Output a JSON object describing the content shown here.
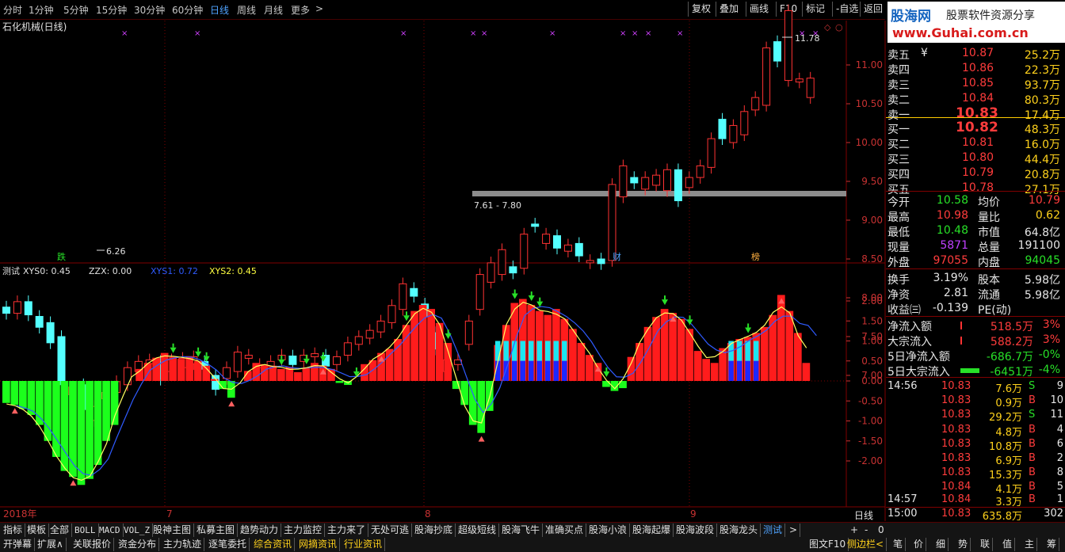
{
  "toolbar": {
    "periods": [
      "分时",
      "1分钟",
      "5分钟",
      "15分钟",
      "30分钟",
      "60分钟",
      "日线",
      "周线",
      "月线",
      "更多"
    ],
    "active_period": "日线",
    "buttons": [
      "复权",
      "叠加",
      "画线",
      "F10",
      "标记",
      "-自选",
      "返回"
    ]
  },
  "brand": {
    "name": "股海网",
    "slogan": "股票软件资源分享",
    "url": "www.Guhai.com.cn"
  },
  "chart": {
    "title": "石化机械(日线)",
    "high_label": "11.78",
    "low_label": "6.26",
    "zone_label": "7.61 - 7.80",
    "events": [
      "跌",
      "财",
      "榜"
    ],
    "price_axis": [
      "11.00",
      "10.50",
      "10.00",
      "9.50",
      "9.00",
      "8.50",
      "8.00",
      "7.50",
      "7.00"
    ],
    "indicator_header": {
      "name": "测试",
      "xys0": "XYS0: 0.45",
      "zzx": "ZZX: 0.00",
      "xys1": "XYS1: 0.72",
      "xys2": "XYS2: 0.45"
    },
    "indicator_axis": [
      "2.00",
      "1.50",
      "1.00",
      "0.50",
      "0.00",
      "-0.50",
      "-1.00",
      "-1.50",
      "-2.00"
    ],
    "date_labels": [
      "2018年",
      "7",
      "8",
      "9"
    ],
    "period_label": "日线"
  },
  "chart_data": {
    "type": "candlestick",
    "title": "石化机械(日线)",
    "ylim": [
      6.5,
      12.0
    ],
    "candles": [
      {
        "o": 7.88,
        "c": 7.8
      },
      {
        "o": 7.8,
        "c": 7.95
      },
      {
        "o": 7.95,
        "c": 7.78
      },
      {
        "o": 7.76,
        "c": 7.62
      },
      {
        "o": 7.68,
        "c": 7.42
      },
      {
        "o": 7.5,
        "c": 6.88
      },
      {
        "o": 6.75,
        "c": 6.85
      },
      {
        "o": 6.88,
        "c": 6.56
      },
      {
        "o": 6.42,
        "c": 6.6
      },
      {
        "o": 6.7,
        "c": 6.78
      },
      {
        "o": 6.78,
        "c": 6.92
      },
      {
        "o": 6.88,
        "c": 7.1
      },
      {
        "o": 7.05,
        "c": 7.18
      },
      {
        "o": 7.15,
        "c": 7.2
      },
      {
        "o": 7.18,
        "c": 6.95
      },
      {
        "o": 7.05,
        "c": 7.2
      },
      {
        "o": 7.1,
        "c": 7.22
      },
      {
        "o": 7.15,
        "c": 7.24
      },
      {
        "o": 7.18,
        "c": 7.08
      },
      {
        "o": 7.0,
        "c": 6.82
      },
      {
        "o": 6.96,
        "c": 7.1
      },
      {
        "o": 7.05,
        "c": 7.3
      },
      {
        "o": 7.22,
        "c": 7.26
      },
      {
        "o": 7.1,
        "c": 7.14
      },
      {
        "o": 7.12,
        "c": 7.18
      },
      {
        "o": 7.2,
        "c": 7.26
      },
      {
        "o": 7.25,
        "c": 7.14
      },
      {
        "o": 7.18,
        "c": 7.26
      },
      {
        "o": 7.24,
        "c": 7.28
      },
      {
        "o": 7.26,
        "c": 7.12
      },
      {
        "o": 7.14,
        "c": 7.24
      },
      {
        "o": 7.26,
        "c": 7.42
      },
      {
        "o": 7.4,
        "c": 7.5
      },
      {
        "o": 7.48,
        "c": 7.58
      },
      {
        "o": 7.56,
        "c": 7.7
      },
      {
        "o": 7.68,
        "c": 7.9
      },
      {
        "o": 7.85,
        "c": 8.18
      },
      {
        "o": 8.12,
        "c": 8.02
      },
      {
        "o": 7.92,
        "c": 7.76
      },
      {
        "o": 7.55,
        "c": 7.34
      },
      {
        "o": 7.05,
        "c": 7.2
      },
      {
        "o": 7.14,
        "c": 7.2
      },
      {
        "o": 7.4,
        "c": 7.7
      },
      {
        "o": 7.85,
        "c": 8.3
      },
      {
        "o": 8.2,
        "c": 8.45
      },
      {
        "o": 8.3,
        "c": 8.62
      },
      {
        "o": 8.4,
        "c": 8.32
      },
      {
        "o": 8.38,
        "c": 8.82
      },
      {
        "o": 8.95,
        "c": 8.92
      },
      {
        "o": 8.7,
        "c": 8.82
      },
      {
        "o": 8.8,
        "c": 8.64
      },
      {
        "o": 8.6,
        "c": 8.68
      },
      {
        "o": 8.7,
        "c": 8.54
      },
      {
        "o": 8.45,
        "c": 8.48
      },
      {
        "o": 8.5,
        "c": 8.44
      },
      {
        "o": 8.48,
        "c": 9.46
      },
      {
        "o": 9.3,
        "c": 9.7
      },
      {
        "o": 9.55,
        "c": 9.48
      },
      {
        "o": 9.4,
        "c": 9.55
      },
      {
        "o": 9.45,
        "c": 9.58
      },
      {
        "o": 9.38,
        "c": 9.65
      },
      {
        "o": 9.65,
        "c": 9.25
      },
      {
        "o": 9.42,
        "c": 9.55
      },
      {
        "o": 9.55,
        "c": 9.7
      },
      {
        "o": 9.68,
        "c": 10.05
      },
      {
        "o": 10.3,
        "c": 10.05
      },
      {
        "o": 10.0,
        "c": 10.22
      },
      {
        "o": 10.1,
        "c": 10.4
      },
      {
        "o": 10.42,
        "c": 10.58
      },
      {
        "o": 10.48,
        "c": 11.22
      },
      {
        "o": 11.3,
        "c": 11.05
      },
      {
        "o": 10.8,
        "c": 11.7
      },
      {
        "o": 10.78,
        "c": 10.82
      },
      {
        "o": 10.58,
        "c": 10.83
      }
    ],
    "indicator": {
      "bars": [
        -0.55,
        -0.6,
        -0.7,
        -0.85,
        -1.1,
        -1.5,
        -1.9,
        -2.25,
        -2.4,
        -2.6,
        -2.45,
        -2.1,
        -1.5,
        -1.1,
        0,
        0,
        0.3,
        0.45,
        0.58,
        0.7,
        0.6,
        0.55,
        0.62,
        0.5,
        0.38,
        0.05,
        -0.2,
        -0.42,
        0,
        0.25,
        0.45,
        0.4,
        0.38,
        0.3,
        0.35,
        0.22,
        0.32,
        0.45,
        0.38,
        0.3,
        -0.05,
        -0.1,
        0,
        0.42,
        0.52,
        0.7,
        0.8,
        1.05,
        1.4,
        1.75,
        1.9,
        1.8,
        1.45,
        0.95,
        -0.2,
        -0.6,
        -1.1,
        -1.3,
        -0.75,
        0.9,
        1.4,
        1.95,
        2.05,
        1.9,
        1.75,
        1.65,
        1.8,
        1.55,
        1.3,
        0.95,
        0.65,
        0.45,
        -0.15,
        -0.25,
        -0.18,
        0.6,
        0.95,
        1.35,
        1.6,
        1.8,
        1.7,
        1.55,
        1.3,
        0.75,
        0.55,
        0.45,
        0.82,
        0.95,
        1.05,
        1.1,
        1.2,
        1.35,
        1.65,
        2.15,
        1.75,
        1.2,
        0.45
      ],
      "xys0": 0.45,
      "zzx": 0.0,
      "xys1": 0.72,
      "xys2": 0.45
    }
  },
  "quote": {
    "sell": [
      {
        "label": "卖五",
        "price": "10.87",
        "vol": "25.2万"
      },
      {
        "label": "卖四",
        "price": "10.86",
        "vol": "22.3万"
      },
      {
        "label": "卖三",
        "price": "10.85",
        "vol": "93.7万"
      },
      {
        "label": "卖二",
        "price": "10.84",
        "vol": "80.3万"
      },
      {
        "label": "卖一",
        "price": "10.83",
        "vol": "17.4万"
      }
    ],
    "buy": [
      {
        "label": "买一",
        "price": "10.82",
        "vol": "48.3万"
      },
      {
        "label": "买二",
        "price": "10.81",
        "vol": "16.0万"
      },
      {
        "label": "买三",
        "price": "10.80",
        "vol": "44.4万"
      },
      {
        "label": "买四",
        "price": "10.79",
        "vol": "20.8万"
      },
      {
        "label": "买五",
        "price": "10.78",
        "vol": "27.1万"
      }
    ],
    "currency_mark": "¥",
    "stats": [
      {
        "l1": "今开",
        "v1": "10.58",
        "l2": "均价",
        "v2": "10.79"
      },
      {
        "l1": "最高",
        "v1": "10.98",
        "l2": "量比",
        "v2": "0.62"
      },
      {
        "l1": "最低",
        "v1": "10.48",
        "l2": "市值",
        "v2": "64.8亿"
      },
      {
        "l1": "现量",
        "v1": "5871",
        "l2": "总量",
        "v2": "191100"
      },
      {
        "l1": "外盘",
        "v1": "97055",
        "l2": "内盘",
        "v2": "94045"
      }
    ],
    "fundamentals": [
      {
        "l1": "换手",
        "v1": "3.19%",
        "l2": "股本",
        "v2": "5.98亿"
      },
      {
        "l1": "净资",
        "v1": "2.81",
        "l2": "流通",
        "v2": "5.98亿"
      },
      {
        "l1": "收益㈢",
        "v1": "-0.139",
        "l2": "PE(动)",
        "v2": ""
      }
    ],
    "flows": [
      {
        "label": "净流入额",
        "value": "518.5万",
        "pct": "3%"
      },
      {
        "label": "大宗流入",
        "value": "588.2万",
        "pct": "3%"
      },
      {
        "label": "5日净流入额",
        "value": "-686.7万",
        "pct": "-0%"
      },
      {
        "label": "5日大宗流入",
        "value": "-6451万",
        "pct": "-4%"
      }
    ],
    "ticks": [
      {
        "time": "14:56",
        "price": "10.83",
        "vol": "7.6万",
        "dir": "S",
        "n": "9"
      },
      {
        "time": "",
        "price": "10.83",
        "vol": "0.9万",
        "dir": "B",
        "n": "10"
      },
      {
        "time": "",
        "price": "10.83",
        "vol": "29.2万",
        "dir": "S",
        "n": "11"
      },
      {
        "time": "",
        "price": "10.83",
        "vol": "4.8万",
        "dir": "B",
        "n": "4"
      },
      {
        "time": "",
        "price": "10.83",
        "vol": "10.8万",
        "dir": "B",
        "n": "6"
      },
      {
        "time": "",
        "price": "10.83",
        "vol": "6.9万",
        "dir": "B",
        "n": "2"
      },
      {
        "time": "",
        "price": "10.83",
        "vol": "15.3万",
        "dir": "B",
        "n": "8"
      },
      {
        "time": "",
        "price": "10.84",
        "vol": "4.1万",
        "dir": "B",
        "n": "5"
      },
      {
        "time": "14:57",
        "price": "10.84",
        "vol": "3.3万",
        "dir": "B",
        "n": "1"
      },
      {
        "time": "15:00",
        "price": "10.83",
        "vol": "635.8万",
        "dir": "",
        "n": "302"
      }
    ]
  },
  "bottom_tabs": [
    "指标",
    "模板",
    "全部",
    "BOLL",
    "MACD",
    "VOL_Z",
    "股神主图",
    "私募主图",
    "趋势动力",
    "主力监控",
    "主力来了",
    "无处可逃",
    "股海抄底",
    "超级短线",
    "股海飞牛",
    "准确买点",
    "股海小浪",
    "股海起爆",
    "股海波段",
    "股海龙头",
    "测试"
  ],
  "bottom_tabs_active": "测试",
  "bottom_controls": [
    "+",
    "-",
    "0"
  ],
  "info_tabs": [
    "开弹幕",
    "扩展∧",
    "关联报价",
    "资金分布",
    "主力轨迹",
    "逐笔委托",
    "综合资讯",
    "网摘资讯",
    "行业资讯"
  ],
  "right_bottom": [
    "图文F10",
    "侧边栏<",
    "笔",
    "价",
    "细",
    "势",
    "联",
    "值",
    "主",
    "筹"
  ]
}
